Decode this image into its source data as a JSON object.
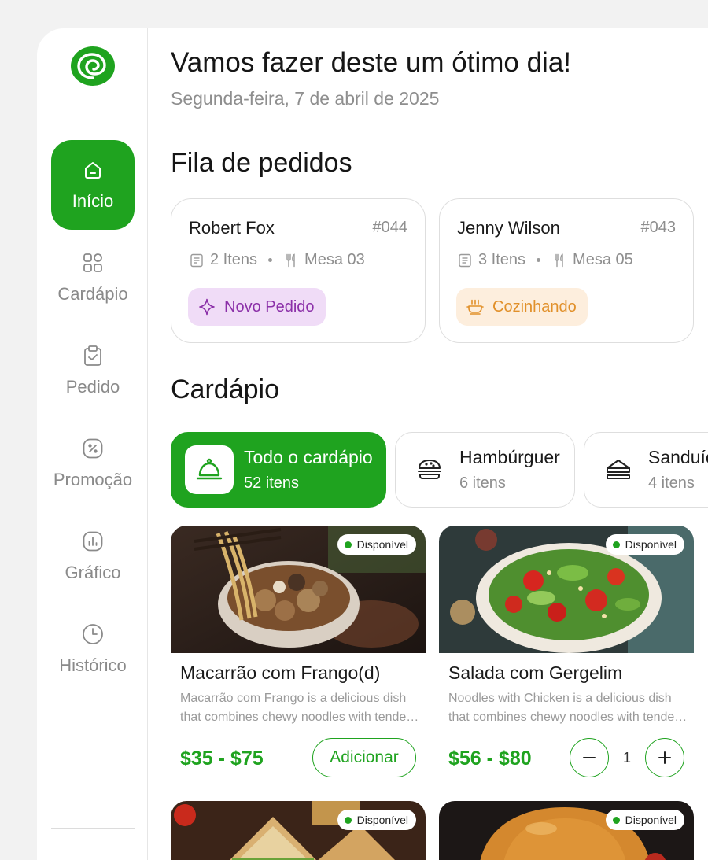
{
  "sidebar": {
    "items": [
      {
        "label": "Início",
        "icon": "home-icon",
        "active": true
      },
      {
        "label": "Cardápio",
        "icon": "grid-icon",
        "active": false
      },
      {
        "label": "Pedido",
        "icon": "clipboard-icon",
        "active": false
      },
      {
        "label": "Promoção",
        "icon": "discount-icon",
        "active": false
      },
      {
        "label": "Gráfico",
        "icon": "chart-icon",
        "active": false
      },
      {
        "label": "Histórico",
        "icon": "clock-icon",
        "active": false
      }
    ]
  },
  "header": {
    "greeting": "Vamos fazer deste um ótimo dia!",
    "date": "Segunda-feira, 7 de abril de 2025"
  },
  "orders": {
    "title": "Fila de pedidos",
    "items": [
      {
        "name": "Robert Fox",
        "number": "#044",
        "items": "2 Itens",
        "table": "Mesa 03",
        "status": "Novo Pedido"
      },
      {
        "name": "Jenny Wilson",
        "number": "#043",
        "items": "3 Itens",
        "table": "Mesa 05",
        "status": "Cozinhando"
      }
    ]
  },
  "menu": {
    "title": "Cardápio",
    "categories": [
      {
        "name": "Todo o cardápio",
        "count": "52 itens",
        "active": true
      },
      {
        "name": "Hambúrguer",
        "count": "6 itens",
        "active": false
      },
      {
        "name": "Sanduíche",
        "count": "4 itens",
        "active": false
      }
    ],
    "items": [
      {
        "title": "Macarrão com Frango(d)",
        "desc1": "Macarrão com Frango is a delicious dish",
        "desc2": "that combines chewy noodles with tender chicken",
        "price": "$35 - $75",
        "badge": "Disponível",
        "action": "Adicionar"
      },
      {
        "title": "Salada com Gergelim",
        "desc1": "Noodles with Chicken is a delicious dish",
        "desc2": "that combines chewy noodles with tender chicken",
        "price": "$56 - $80",
        "badge": "Disponível",
        "quantity": "1"
      },
      {
        "badge": "Disponível"
      },
      {
        "badge": "Disponível"
      }
    ]
  },
  "colors": {
    "accent": "#1fa31f",
    "new_order_bg": "#f0dcf7",
    "new_order_text": "#8b2fa8",
    "cooking_bg": "#fdeedd",
    "cooking_text": "#e1902a"
  }
}
